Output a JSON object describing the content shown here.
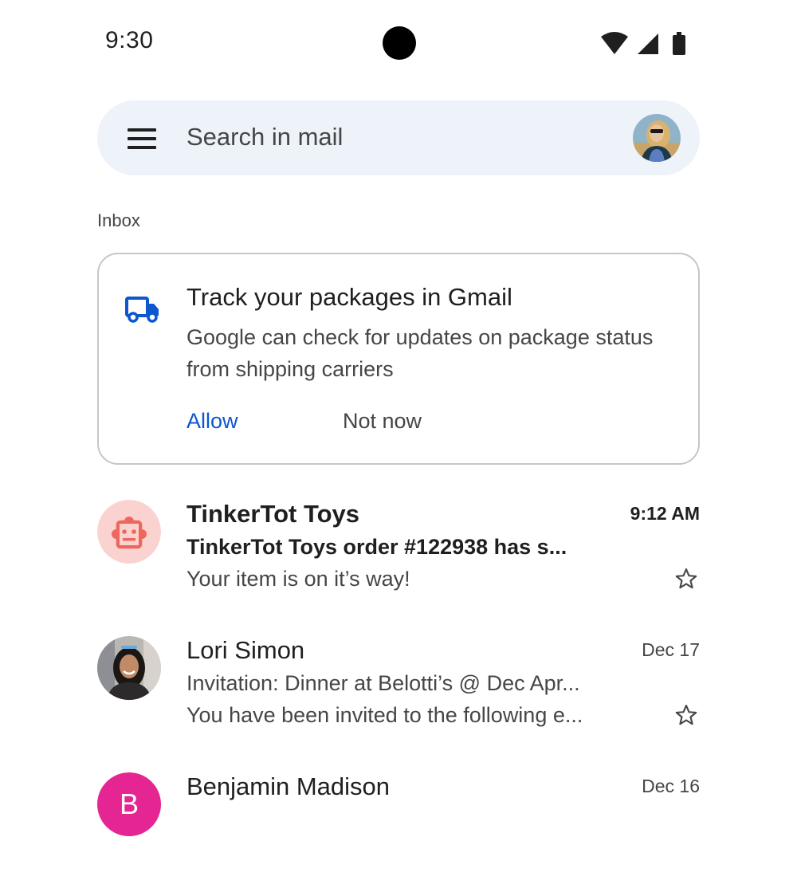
{
  "status_bar": {
    "time": "9:30",
    "icons": [
      "wifi-icon",
      "cellular-signal-icon",
      "battery-icon"
    ]
  },
  "search": {
    "placeholder": "Search in mail",
    "menu_icon": "hamburger-menu-icon",
    "account_avatar": "account-avatar"
  },
  "section_label": "Inbox",
  "promo": {
    "icon": "truck-icon",
    "title": "Track your packages in Gmail",
    "body": "Google can check for updates on package status from shipping carriers",
    "allow_label": "Allow",
    "not_now_label": "Not now",
    "accent_color": "#0b57d0"
  },
  "emails": [
    {
      "sender": "TinkerTot Toys",
      "subject": "TinkerTot Toys order #122938 has s...",
      "snippet": "Your item is on it’s way!",
      "date": "9:12 AM",
      "unread": true,
      "avatar_type": "robot-icon",
      "starred": false
    },
    {
      "sender": "Lori Simon",
      "subject": "Invitation: Dinner at Belotti’s @ Dec Apr...",
      "snippet": "You have been invited to the following e...",
      "date": "Dec 17",
      "unread": false,
      "avatar_type": "photo",
      "starred": false
    },
    {
      "sender": "Benjamin Madison",
      "date": "Dec 16",
      "avatar_letter": "B",
      "avatar_color": "#e52592",
      "unread": false
    }
  ]
}
